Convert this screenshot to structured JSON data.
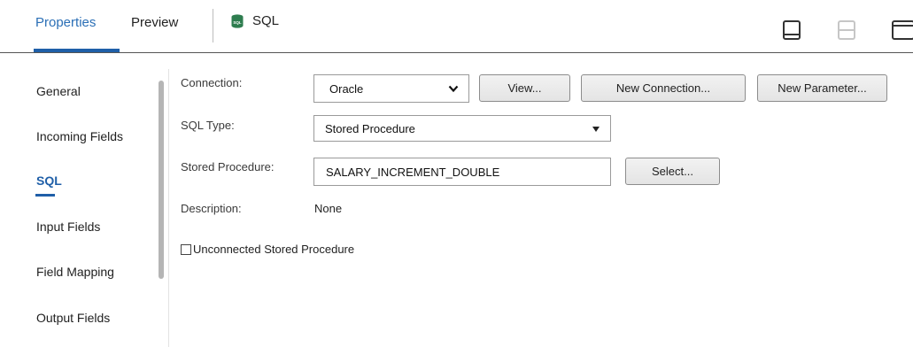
{
  "tabs": {
    "properties": "Properties",
    "preview": "Preview",
    "sql": "SQL",
    "sql_icon_text": "SQL"
  },
  "layout_buttons": [
    "panel-bottom-icon",
    "panel-split-icon",
    "panel-maximize-icon"
  ],
  "nav": {
    "items": [
      "General",
      "Incoming Fields",
      "SQL",
      "Input Fields",
      "Field Mapping",
      "Output Fields"
    ],
    "active": "SQL"
  },
  "form": {
    "connection_label": "Connection:",
    "connection_value": "Oracle",
    "view_button": "View...",
    "new_connection_button": "New Connection...",
    "new_parameter_button": "New Parameter...",
    "sql_type_label": "SQL Type:",
    "sql_type_value": "Stored Procedure",
    "stored_procedure_label": "Stored Procedure:",
    "stored_procedure_value": "SALARY_INCREMENT_DOUBLE",
    "select_button": "Select...",
    "description_label": "Description:",
    "description_value": "None",
    "unconnected_label": "Unconnected Stored Procedure",
    "unconnected_checked": false
  },
  "colors": {
    "accent": "#1f5fa8",
    "db_icon": "#2e7d4f"
  }
}
